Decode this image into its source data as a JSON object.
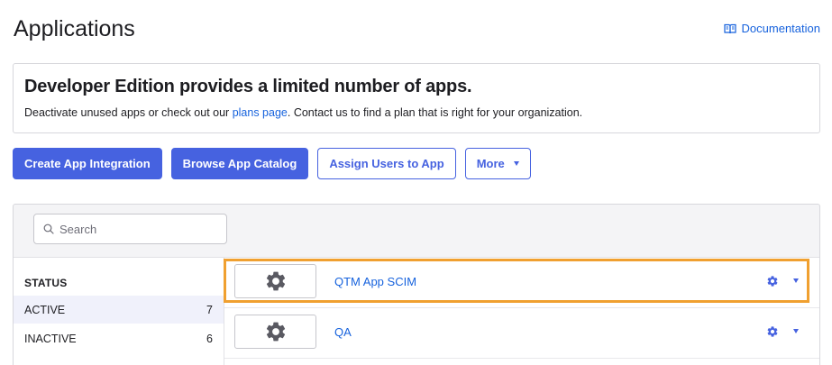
{
  "header": {
    "title": "Applications",
    "doc_link": "Documentation",
    "doc_icon": "book-icon"
  },
  "banner": {
    "title": "Developer Edition provides a limited number of apps.",
    "text_before": "Deactivate unused apps or check out our ",
    "link": "plans page",
    "text_after": ". Contact us to find a plan that is right for your organization."
  },
  "toolbar": {
    "create_label": "Create App Integration",
    "browse_label": "Browse App Catalog",
    "assign_label": "Assign Users to App",
    "more_label": "More"
  },
  "search": {
    "placeholder": "Search"
  },
  "sidebar": {
    "heading": "STATUS",
    "items": [
      {
        "label": "ACTIVE",
        "count": "7"
      },
      {
        "label": "INACTIVE",
        "count": "6"
      }
    ]
  },
  "apps": [
    {
      "name": "QTM App SCIM",
      "logo_icon": "gear-icon"
    },
    {
      "name": "QA",
      "logo_icon": "gear-icon"
    }
  ],
  "colors": {
    "primary": "#4662e0",
    "link": "#1662dd",
    "highlight": "#f0a030"
  }
}
